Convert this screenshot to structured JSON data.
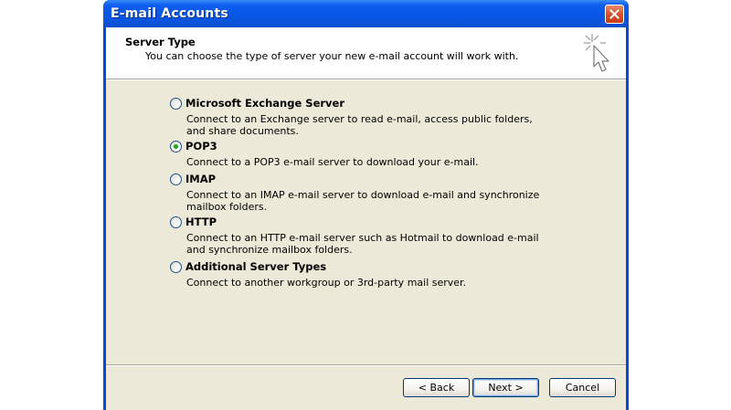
{
  "window": {
    "title": "E-mail Accounts"
  },
  "header": {
    "title": "Server Type",
    "subtitle": "You can choose the type of server your new e-mail account will work with.",
    "icon": "wizard-star-cursor-icon"
  },
  "options": [
    {
      "label": "Microsoft Exchange Server",
      "description": "Connect to an Exchange server to read e-mail, access public folders, and share documents.",
      "selected": false
    },
    {
      "label": "POP3",
      "description": "Connect to a POP3 e-mail server to download your e-mail.",
      "selected": true
    },
    {
      "label": "IMAP",
      "description": "Connect to an IMAP e-mail server to download e-mail and synchronize mailbox folders.",
      "selected": false
    },
    {
      "label": "HTTP",
      "description": "Connect to an HTTP e-mail server such as Hotmail to download e-mail and synchronize mailbox folders.",
      "selected": false
    },
    {
      "label": "Additional Server Types",
      "description": "Connect to another workgroup or 3rd-party mail server.",
      "selected": false
    }
  ],
  "buttons": {
    "back": "< Back",
    "next": "Next >",
    "cancel": "Cancel"
  },
  "colors": {
    "titlebar": "#0858e6",
    "dialog_bg": "#ece9d8",
    "radio_selected": "#21a121"
  }
}
